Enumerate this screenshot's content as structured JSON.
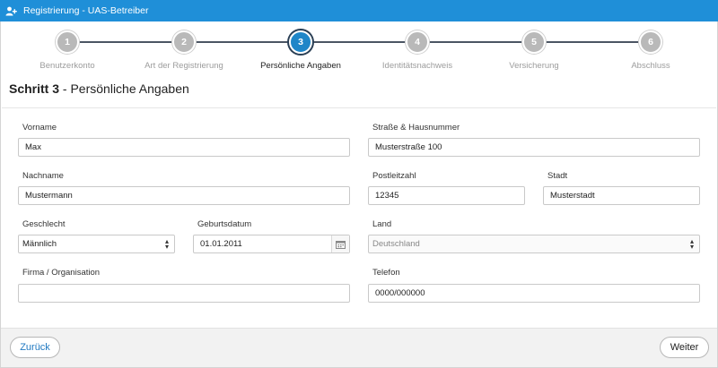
{
  "window": {
    "title": "Registrierung - UAS-Betreiber",
    "title_icon": "add-user-icon"
  },
  "stepper": {
    "steps": [
      {
        "number": "1",
        "label": "Benutzerkonto",
        "active": false
      },
      {
        "number": "2",
        "label": "Art der Registrierung",
        "active": false
      },
      {
        "number": "3",
        "label": "Persönliche Angaben",
        "active": true
      },
      {
        "number": "4",
        "label": "Identitätsnachweis",
        "active": false
      },
      {
        "number": "5",
        "label": "Versicherung",
        "active": false
      },
      {
        "number": "6",
        "label": "Abschluss",
        "active": false
      }
    ]
  },
  "heading": {
    "step": "Schritt 3",
    "separator": " - ",
    "title": "Persönliche Angaben"
  },
  "form": {
    "vorname": {
      "label": "Vorname",
      "value": "Max"
    },
    "nachname": {
      "label": "Nachname",
      "value": "Mustermann"
    },
    "geschlecht": {
      "label": "Geschlecht",
      "value": "Männlich"
    },
    "geburtsdatum": {
      "label": "Geburtsdatum",
      "value": "01.01.2011"
    },
    "firma": {
      "label": "Firma / Organisation",
      "value": ""
    },
    "strasse": {
      "label": "Straße & Hausnummer",
      "value": "Musterstraße 100"
    },
    "plz": {
      "label": "Postleitzahl",
      "value": "12345"
    },
    "stadt": {
      "label": "Stadt",
      "value": "Musterstadt"
    },
    "land": {
      "label": "Land",
      "value": "Deutschland"
    },
    "telefon": {
      "label": "Telefon",
      "value": "0000/000000"
    }
  },
  "footer": {
    "back_label": "Zurück",
    "next_label": "Weiter"
  },
  "colors": {
    "titlebar": "#1f8fd8",
    "active_step": "#1f86c8",
    "inactive_step": "#b9b9b9",
    "back_link": "#1f78c1"
  }
}
